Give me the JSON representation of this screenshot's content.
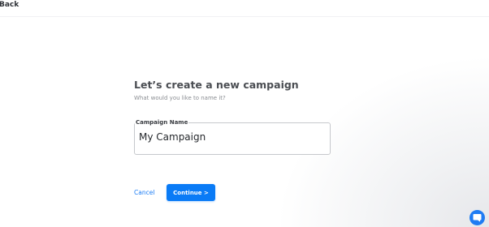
{
  "header": {
    "back_label": "Back"
  },
  "form": {
    "title": "Let’s create a new campaign",
    "subtitle": "What would you like to name it?",
    "field_label": "Campaign Name",
    "field_value": "My Campaign",
    "cancel_label": "Cancel",
    "continue_label": "Continue >"
  },
  "chat_widget": {
    "icon": "chat-icon"
  },
  "colors": {
    "accent": "#0a7bf6",
    "link": "#1a7cf5",
    "heading": "#4a4d52"
  }
}
